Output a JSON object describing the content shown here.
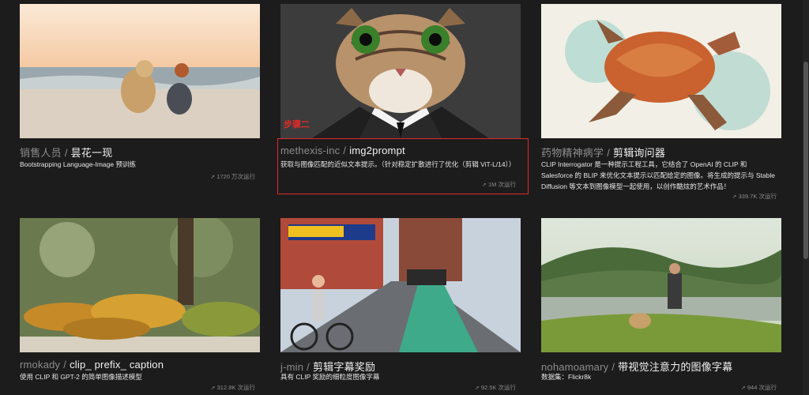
{
  "annotation": {
    "step_label": "步骤二"
  },
  "cards": [
    {
      "owner": "销售人员",
      "model": "昙花一现",
      "description": "Bootstrapping Language-Image 预训练",
      "runs": "1720 万次运行"
    },
    {
      "owner": "methexis-inc",
      "model": "img2prompt",
      "description": "获取与图像匹配的近似文本提示。（针对稳定扩散进行了优化（剪辑 ViT-L/14））",
      "runs": "1M 次运行"
    },
    {
      "owner": "药物精神病学",
      "model": "剪辑询问器",
      "description": "CLIP Interrogator 是一种提示工程工具，它结合了 OpenAI 的 CLIP 和 Salesforce 的 BLIP 来优化文本提示以匹配给定的图像。将生成的提示与 Stable Diffusion 等文本到图像模型一起使用，以创作酷炫的艺术作品！",
      "runs": "339.7K 次运行"
    },
    {
      "owner": "rmokady",
      "model": "clip_ prefix_ caption",
      "description": "使用 CLIP 和 GPT-2 的简单图像描述模型",
      "runs": "312.8K 次运行"
    },
    {
      "owner": "j-min",
      "model": "剪辑字幕奖励",
      "description": "具有 CLIP 奖励的细粒度图像字幕",
      "runs": "92.5K 次运行"
    },
    {
      "owner": "nohamoamary",
      "model": "带视觉注意力的图像字幕",
      "description": "数据集：Flickr8k",
      "runs": "944 次运行"
    }
  ],
  "colors": {
    "highlight": "#e02a2a",
    "background": "#1c1c1c"
  }
}
